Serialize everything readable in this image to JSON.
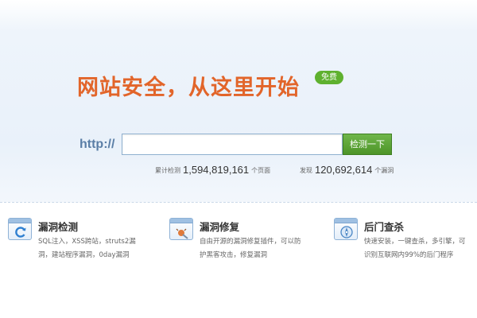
{
  "hero": {
    "headline": "网站安全，从这里开始",
    "badge": "免费"
  },
  "search": {
    "protocol_label": "http://",
    "value": "",
    "button_label": "检测一下"
  },
  "stats": {
    "scanned_prefix": "累计检测",
    "scanned_count": "1,594,819,161",
    "scanned_suffix": "个页面",
    "found_prefix": "发现",
    "found_count": "120,692,614",
    "found_suffix": "个漏洞"
  },
  "features": [
    {
      "icon": "refresh-icon",
      "title": "漏洞检测",
      "desc": "SQL注入，XSS跨站，struts2漏洞，建站程序漏洞，0day漏洞"
    },
    {
      "icon": "bug-wrench-icon",
      "title": "漏洞修复",
      "desc": "自由开源的漏洞修复插件，可以防护黑客攻击，修复漏洞"
    },
    {
      "icon": "compass-icon",
      "title": "后门查杀",
      "desc": "快速安装，一键查杀，多引擎，可识别互联网内99%的后门程序"
    }
  ],
  "colors": {
    "headline": "#e2652a",
    "badge": "#5fb12f",
    "button": "#4d9428",
    "http_label": "#5a7ea6"
  }
}
